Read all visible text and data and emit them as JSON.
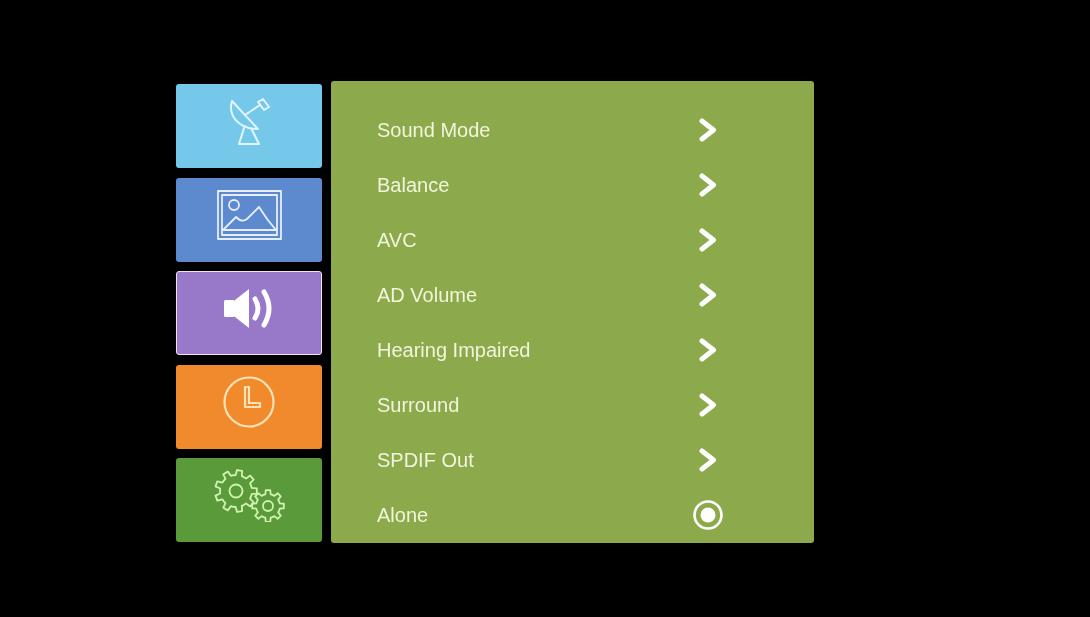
{
  "sidebar": {
    "items": [
      {
        "color": "#76c8ea",
        "selected": false
      },
      {
        "color": "#5d89cf",
        "selected": false
      },
      {
        "color": "#9878c8",
        "selected": true
      },
      {
        "color": "#f08a2c",
        "selected": false
      },
      {
        "color": "#5a9a3a",
        "selected": false
      }
    ]
  },
  "settings_menu": {
    "items": [
      {
        "label": "Sound Mode",
        "kind": "submenu"
      },
      {
        "label": "Balance",
        "kind": "submenu"
      },
      {
        "label": "AVC",
        "kind": "submenu"
      },
      {
        "label": "AD Volume",
        "kind": "submenu"
      },
      {
        "label": "Hearing Impaired",
        "kind": "submenu"
      },
      {
        "label": "Surround",
        "kind": "submenu"
      },
      {
        "label": "SPDIF Out",
        "kind": "submenu"
      },
      {
        "label": "Alone",
        "kind": "radio",
        "checked": true
      }
    ]
  }
}
